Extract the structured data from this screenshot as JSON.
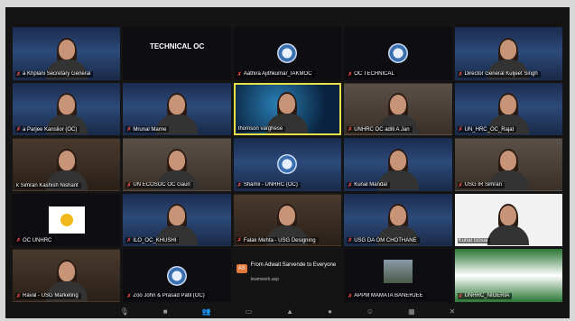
{
  "meeting": {
    "tiles": [
      {
        "name": "a Khplani Secretary General",
        "bg": "bg-un",
        "muted": true,
        "person": true
      },
      {
        "name": "",
        "bg": "bg-dark",
        "muted": false,
        "person": false,
        "label": "TECHNICAL OC"
      },
      {
        "name": "Aathira Ajithkumar_IAKMOC",
        "bg": "bg-dark",
        "muted": true,
        "person": false,
        "logo": true
      },
      {
        "name": "OC TECHNICAL",
        "bg": "bg-dark",
        "muted": true,
        "person": false,
        "logo": true
      },
      {
        "name": "Director General Kuljeet Singh",
        "bg": "bg-un",
        "muted": true,
        "person": true
      },
      {
        "name": "a Parjee Kanslior (OC)",
        "bg": "bg-un",
        "muted": true,
        "person": true
      },
      {
        "name": "Mrunal Marne",
        "bg": "bg-un",
        "muted": true,
        "person": true
      },
      {
        "name": "thomson varghese",
        "bg": "bg-tech",
        "muted": false,
        "person": true,
        "active": true
      },
      {
        "name": "UNHRC OC aditi A Jan",
        "bg": "bg-room2",
        "muted": true,
        "person": true
      },
      {
        "name": "UN_HRC_OC_Rajat",
        "bg": "bg-un",
        "muted": true,
        "person": true
      },
      {
        "name": "k Simran Kashish Nishant",
        "bg": "bg-room",
        "muted": false,
        "person": true
      },
      {
        "name": "UN ECOSOC OC Gauri",
        "bg": "bg-room2",
        "muted": true,
        "person": true
      },
      {
        "name": "Shamli - UNHRC (OC)",
        "bg": "bg-un",
        "muted": true,
        "person": false,
        "logo": true
      },
      {
        "name": "Kunal Mandal",
        "bg": "bg-un",
        "muted": true,
        "person": true
      },
      {
        "name": "USG IR Simran",
        "bg": "bg-room2",
        "muted": true,
        "person": true
      },
      {
        "name": "OC UNHRC",
        "bg": "bg-dark",
        "muted": true,
        "person": false,
        "yellowlogo": true
      },
      {
        "name": "ILO_OC_KHUSHI",
        "bg": "bg-un",
        "muted": true,
        "person": true
      },
      {
        "name": "Falak Mehta - USG Designing",
        "bg": "bg-room",
        "muted": true,
        "person": true
      },
      {
        "name": "USG DA OM CHOTHANE",
        "bg": "bg-un",
        "muted": true,
        "person": true
      },
      {
        "name": "Kunal Gosai",
        "bg": "bg-white",
        "muted": false,
        "person": true
      },
      {
        "name": "Raval - USG Marketing",
        "bg": "bg-room",
        "muted": true,
        "person": true
      },
      {
        "name": "Zoo John & Prasad Patil (OC)",
        "bg": "bg-dark",
        "muted": true,
        "person": false,
        "logo": true
      },
      {
        "name": "",
        "bg": "chat-tile",
        "muted": false,
        "person": false,
        "chat": true
      },
      {
        "name": "APPM MAMATA BANERJEE",
        "bg": "bg-dark",
        "muted": true,
        "person": false,
        "photo": true
      },
      {
        "name": "UNHRC_NIGERIA",
        "bg": "bg-green",
        "muted": true,
        "person": false
      }
    ],
    "chat": {
      "badge": "AS",
      "from": "From Adwait Sarvende to Everyone",
      "message": "teamwork.asp"
    },
    "toolbar_icons": [
      "mic-icon",
      "video-icon",
      "participants-icon",
      "chat-icon",
      "share-icon",
      "record-icon",
      "reactions-icon",
      "apps-icon",
      "end-icon"
    ],
    "colors": {
      "active_border": "#e6e04a",
      "muted": "#e84a4a",
      "chat_badge": "#e0783a"
    }
  }
}
